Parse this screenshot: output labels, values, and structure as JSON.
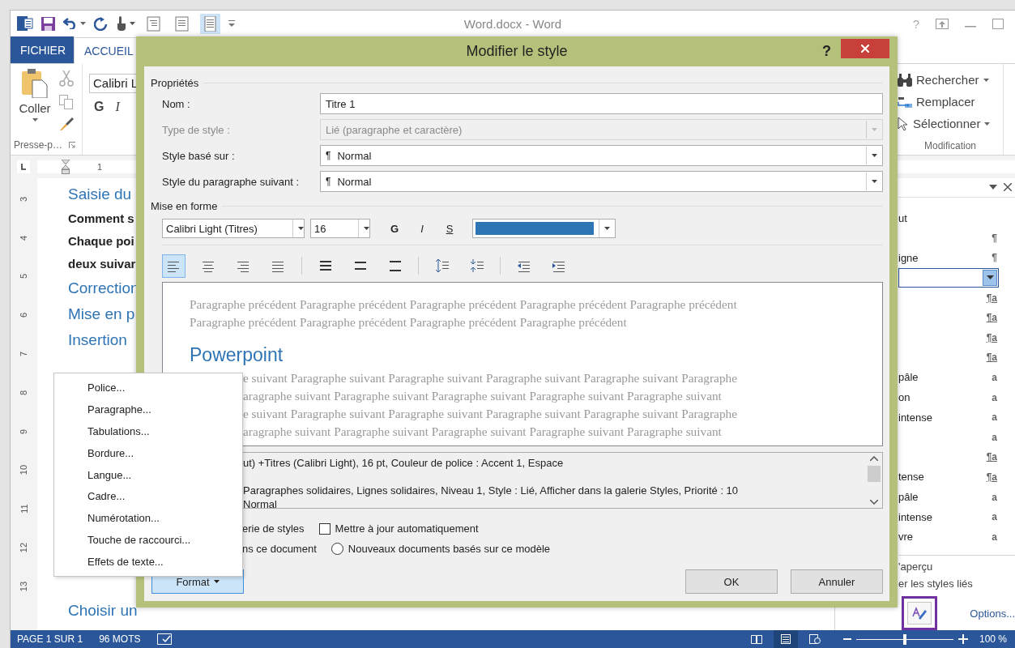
{
  "word": {
    "title": "Word.docx - Word",
    "help": "?",
    "qat_views": [
      {
        "selected": false
      },
      {
        "selected": false
      },
      {
        "selected": true
      }
    ],
    "tabs": [
      {
        "label": "FICHIER",
        "kind": "file",
        "selected": false
      },
      {
        "label": "ACCUEIL",
        "kind": "tab",
        "selected": true
      }
    ],
    "clipboard": {
      "paste": "Coller",
      "group": "Presse-p…"
    },
    "font_box": "Calibri L",
    "font_buttons": [
      {
        "label": "G",
        "kind": "bold"
      },
      {
        "label": "I",
        "kind": "italic"
      }
    ],
    "editing": {
      "items": [
        {
          "label": "Rechercher",
          "kind": "find",
          "dropdown": true
        },
        {
          "label": "Remplacer",
          "kind": "replace",
          "dropdown": false
        },
        {
          "label": "Sélectionner",
          "kind": "select",
          "dropdown": true
        }
      ],
      "group": "Modification"
    },
    "ruler_label": "1",
    "ruler_numbers": [
      "3",
      "4",
      "5",
      "6",
      "7",
      "8",
      "9",
      "10",
      "11",
      "12",
      "13"
    ],
    "document": [
      {
        "text": "Saisie du",
        "kind": "heading"
      },
      {
        "text": "Comment s",
        "kind": "body"
      },
      {
        "text": "Chaque poi",
        "kind": "body"
      },
      {
        "text": "deux suivar",
        "kind": "body"
      },
      {
        "text": "Correction",
        "kind": "heading"
      },
      {
        "text": "Mise en p",
        "kind": "heading"
      },
      {
        "text": "Insertion",
        "kind": "heading"
      },
      {
        "text": "Choisir un",
        "kind": "heading"
      }
    ],
    "styles_pane": {
      "items": [
        {
          "label": "ut",
          "selected": false
        },
        {
          "marker": "¶",
          "kind": "paragraph",
          "selected": false
        },
        {
          "label": "igne",
          "marker": "¶",
          "kind": "paragraph",
          "selected": false
        },
        {
          "selected": true
        },
        {
          "marker": "¶a",
          "kind": "linked",
          "selected": false
        },
        {
          "marker": "¶a",
          "kind": "linked",
          "selected": false
        },
        {
          "marker": "¶a",
          "kind": "linked",
          "selected": false
        },
        {
          "marker": "¶a",
          "kind": "linked",
          "selected": false
        },
        {
          "label": "pâle",
          "marker": "a",
          "kind": "character",
          "selected": false
        },
        {
          "label": "on",
          "marker": "a",
          "kind": "character",
          "selected": false
        },
        {
          "label": "intense",
          "marker": "a",
          "kind": "character",
          "selected": false
        },
        {
          "marker": "a",
          "kind": "character",
          "selected": false
        },
        {
          "marker": "¶a",
          "kind": "linked",
          "selected": false
        },
        {
          "label": "tense",
          "marker": "¶a",
          "kind": "linked",
          "selected": false
        },
        {
          "label": "pâle",
          "marker": "a",
          "kind": "character",
          "selected": false
        },
        {
          "label": "intense",
          "marker": "a",
          "kind": "character",
          "selected": false
        },
        {
          "label": "vre",
          "marker": "a",
          "kind": "character",
          "selected": false
        }
      ],
      "footer": [
        "'aperçu",
        "er les styles liés"
      ],
      "options": "Options..."
    }
  },
  "dialog": {
    "title": "Modifier le style",
    "help": "?",
    "properties": {
      "heading": "Propriétés",
      "rows": [
        {
          "label": "Nom :",
          "value": "Titre 1",
          "kind": "text",
          "disabled": false
        },
        {
          "label": "Type de style :",
          "value": "Lié (paragraphe et caractère)",
          "kind": "select",
          "disabled": true
        },
        {
          "label": "Style basé sur :",
          "icon": "¶",
          "value": "Normal",
          "kind": "select",
          "disabled": false
        },
        {
          "label": "Style du paragraphe suivant :",
          "icon": "¶",
          "value": "Normal",
          "kind": "select",
          "disabled": false
        }
      ]
    },
    "formatting": {
      "heading": "Mise en forme",
      "font": "Calibri Light (Titres)",
      "size": "16",
      "styles": [
        {
          "label": "G",
          "kind": "bold"
        },
        {
          "label": "I",
          "kind": "italic"
        },
        {
          "label": "S",
          "kind": "underline"
        }
      ],
      "alignment": [
        {
          "selected": true
        },
        {
          "selected": false
        },
        {
          "selected": false
        },
        {
          "selected": false
        }
      ]
    },
    "preview": {
      "previous": [
        "Paragraphe précédent Paragraphe précédent Paragraphe précédent Paragraphe précédent Paragraphe précédent",
        "Paragraphe précédent Paragraphe précédent Paragraphe précédent Paragraphe précédent"
      ],
      "heading": "Powerpoint",
      "following": [
        "e suivant Paragraphe suivant Paragraphe suivant Paragraphe suivant Paragraphe suivant Paragraphe",
        "aragraphe suivant Paragraphe suivant Paragraphe suivant Paragraphe suivant Paragraphe suivant",
        "e suivant Paragraphe suivant Paragraphe suivant Paragraphe suivant Paragraphe suivant Paragraphe",
        "aragraphe suivant Paragraphe suivant Paragraphe suivant Paragraphe suivant Paragraphe suivant"
      ]
    },
    "description": [
      "ut) +Titres (Calibri Light), 16 pt, Couleur de police : Accent 1, Espace",
      "Paragraphes solidaires, Lignes solidaires, Niveau 1, Style : Lié, Afficher dans la galerie Styles, Priorité : 10",
      "Normal"
    ],
    "options": [
      {
        "fragment": "erie de styles",
        "label": "Mettre à jour automatiquement",
        "kind": "checkbox",
        "checked": false
      },
      {
        "fragment": "ns ce document",
        "label": "Nouveaux documents basés sur ce modèle",
        "kind": "radio",
        "selected": false
      }
    ],
    "buttons": {
      "format": {
        "label": "Format",
        "open": true
      },
      "ok": "OK",
      "cancel": "Annuler"
    }
  },
  "format_menu": {
    "items": [
      "Police...",
      "Paragraphe...",
      "Tabulations...",
      "Bordure...",
      "Langue...",
      "Cadre...",
      "Numérotation...",
      "Touche de raccourci...",
      "Effets de texte..."
    ]
  },
  "status_bar": {
    "page": "PAGE 1 SUR 1",
    "words": "96 MOTS",
    "views": [
      {
        "selected": false
      },
      {
        "selected": true
      },
      {
        "selected": false
      }
    ],
    "zoom": {
      "level": 0.5,
      "reading": "100 %"
    }
  }
}
